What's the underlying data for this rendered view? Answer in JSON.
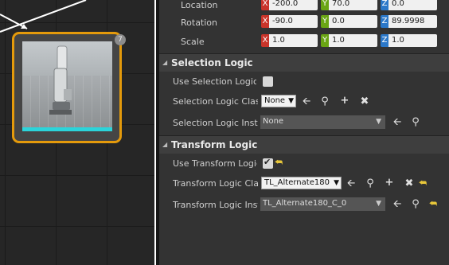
{
  "graph": {
    "node": {
      "badge": "7",
      "accent": "#e49a0b",
      "selected": true
    }
  },
  "transform": {
    "location": {
      "label": "Location",
      "x": "-200.0",
      "y": "70.0",
      "z": "0.0"
    },
    "rotation": {
      "label": "Rotation",
      "x": "-90.0",
      "y": "0.0",
      "z": "89.9998"
    },
    "scale": {
      "label": "Scale",
      "x": "1.0",
      "y": "1.0",
      "z": "1.0"
    },
    "axis_x": "X",
    "axis_y": "Y",
    "axis_z": "Z"
  },
  "selection_logic": {
    "title": "Selection Logic",
    "use_label": "Use Selection Logic",
    "use_checked": false,
    "class_label": "Selection Logic Class",
    "class_value": "None",
    "instance_label": "Selection Logic Instance",
    "instance_value": "None"
  },
  "transform_logic": {
    "title": "Transform Logic",
    "use_label": "Use Transform Logic",
    "use_checked": true,
    "class_label": "Transform Logic Class",
    "class_value": "TL_Alternate180",
    "instance_label": "Transform Logic Instance",
    "instance_value": "TL_Alternate180_C_0"
  },
  "icons": {
    "use_asset": "arrow-left-icon",
    "browse": "magnifier-icon",
    "add": "plus-icon",
    "clear": "x-icon",
    "reset": "reset-arrow-icon"
  },
  "colors": {
    "axis_x": "#c9342a",
    "axis_y": "#6aa514",
    "axis_z": "#2b78c9",
    "reset": "#e8c73a"
  }
}
